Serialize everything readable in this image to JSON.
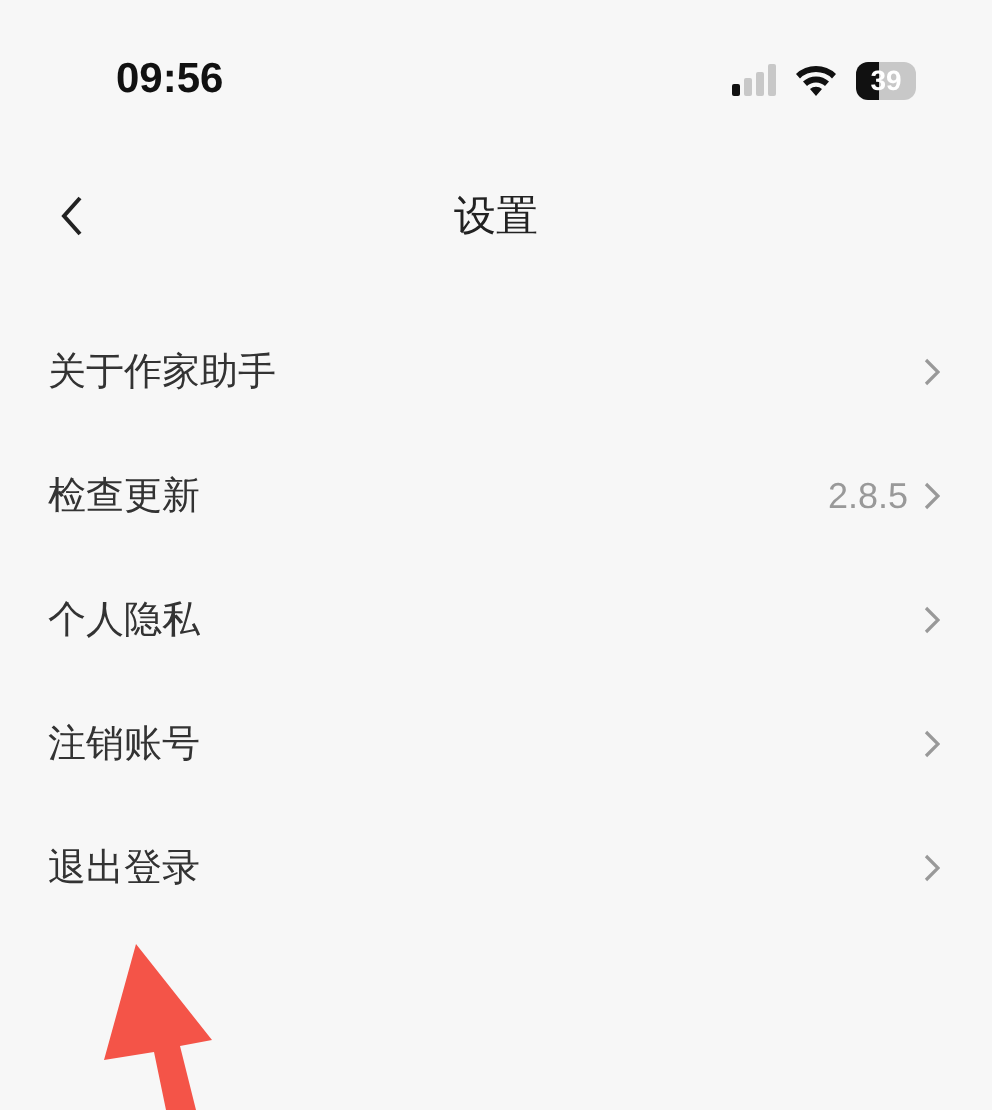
{
  "status_bar": {
    "time": "09:56",
    "battery": "39"
  },
  "nav": {
    "title": "设置"
  },
  "items": [
    {
      "label": "关于作家助手"
    },
    {
      "label": "检查更新",
      "value": "2.8.5"
    },
    {
      "label": "个人隐私"
    },
    {
      "label": "注销账号"
    },
    {
      "label": "退出登录"
    }
  ]
}
